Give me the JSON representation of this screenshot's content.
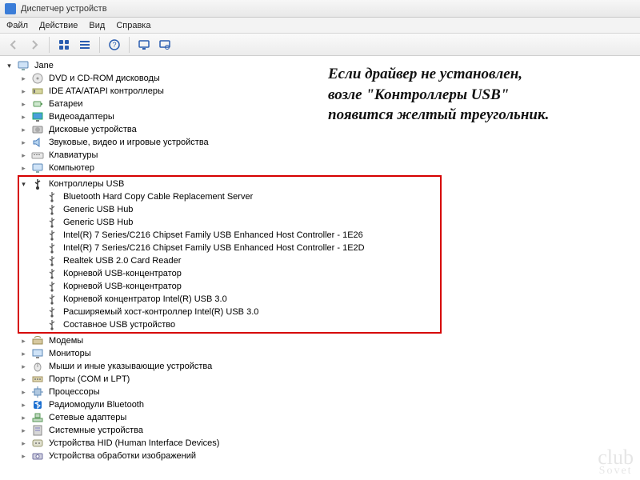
{
  "window": {
    "title": "Диспетчер устройств"
  },
  "menu": {
    "file": "Файл",
    "action": "Действие",
    "view": "Вид",
    "help": "Справка"
  },
  "annotation": {
    "line1": "Если драйвер не установлен,",
    "line2": "возле \"Контроллеры USB\"",
    "line3": "появится желтый треугольник."
  },
  "watermark": {
    "top": "club",
    "bottom": "Sovet"
  },
  "tree": {
    "root": {
      "label": "Jane",
      "icon": "computer"
    },
    "categories": [
      {
        "label": "DVD и CD-ROM дисководы",
        "icon": "disc"
      },
      {
        "label": "IDE ATA/ATAPI контроллеры",
        "icon": "ide"
      },
      {
        "label": "Батареи",
        "icon": "battery"
      },
      {
        "label": "Видеоадаптеры",
        "icon": "display"
      },
      {
        "label": "Дисковые устройства",
        "icon": "hdd"
      },
      {
        "label": "Звуковые, видео и игровые устройства",
        "icon": "sound"
      },
      {
        "label": "Клавиатуры",
        "icon": "keyboard"
      },
      {
        "label": "Компьютер",
        "icon": "computer"
      },
      {
        "label": "Контроллеры USB",
        "icon": "usb",
        "expanded": true,
        "highlighted": true,
        "children": [
          {
            "label": "Bluetooth Hard Copy Cable Replacement Server"
          },
          {
            "label": "Generic USB Hub"
          },
          {
            "label": "Generic USB Hub"
          },
          {
            "label": "Intel(R) 7 Series/C216 Chipset Family USB Enhanced Host Controller - 1E26"
          },
          {
            "label": "Intel(R) 7 Series/C216 Chipset Family USB Enhanced Host Controller - 1E2D"
          },
          {
            "label": "Realtek USB 2.0 Card Reader"
          },
          {
            "label": "Корневой USB-концентратор"
          },
          {
            "label": "Корневой USB-концентратор"
          },
          {
            "label": "Корневой концентратор Intel(R) USB 3.0"
          },
          {
            "label": "Расширяемый хост-контроллер Intel(R) USB 3.0"
          },
          {
            "label": "Составное USB устройство"
          }
        ]
      },
      {
        "label": "Модемы",
        "icon": "modem"
      },
      {
        "label": "Мониторы",
        "icon": "monitor"
      },
      {
        "label": "Мыши и иные указывающие устройства",
        "icon": "mouse"
      },
      {
        "label": "Порты (COM и LPT)",
        "icon": "port"
      },
      {
        "label": "Процессоры",
        "icon": "cpu"
      },
      {
        "label": "Радиомодули Bluetooth",
        "icon": "bluetooth"
      },
      {
        "label": "Сетевые адаптеры",
        "icon": "network"
      },
      {
        "label": "Системные устройства",
        "icon": "system"
      },
      {
        "label": "Устройства HID (Human Interface Devices)",
        "icon": "hid"
      },
      {
        "label": "Устройства обработки изображений",
        "icon": "imaging"
      }
    ]
  }
}
